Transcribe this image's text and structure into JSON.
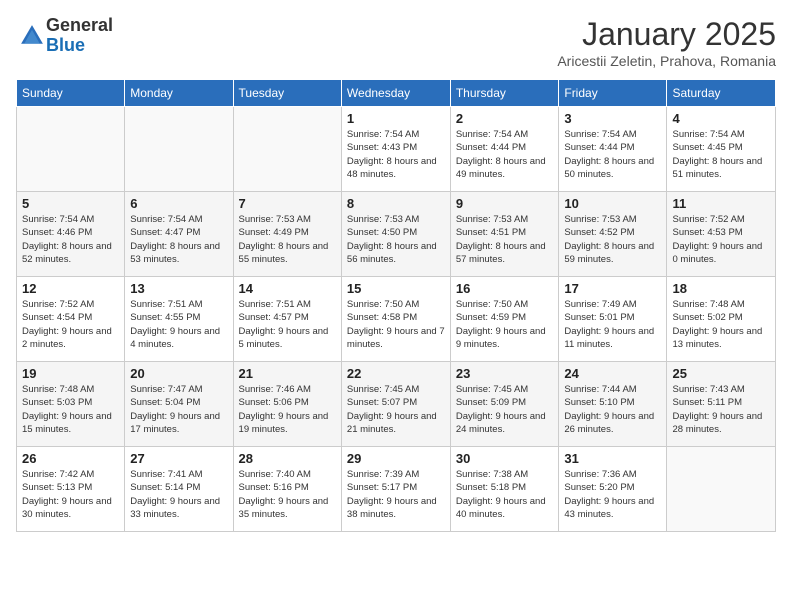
{
  "logo": {
    "general": "General",
    "blue": "Blue"
  },
  "title": "January 2025",
  "location": "Aricestii Zeletin, Prahova, Romania",
  "weekdays": [
    "Sunday",
    "Monday",
    "Tuesday",
    "Wednesday",
    "Thursday",
    "Friday",
    "Saturday"
  ],
  "weeks": [
    [
      {
        "day": "",
        "sunrise": "",
        "sunset": "",
        "daylight": ""
      },
      {
        "day": "",
        "sunrise": "",
        "sunset": "",
        "daylight": ""
      },
      {
        "day": "",
        "sunrise": "",
        "sunset": "",
        "daylight": ""
      },
      {
        "day": "1",
        "sunrise": "Sunrise: 7:54 AM",
        "sunset": "Sunset: 4:43 PM",
        "daylight": "Daylight: 8 hours and 48 minutes."
      },
      {
        "day": "2",
        "sunrise": "Sunrise: 7:54 AM",
        "sunset": "Sunset: 4:44 PM",
        "daylight": "Daylight: 8 hours and 49 minutes."
      },
      {
        "day": "3",
        "sunrise": "Sunrise: 7:54 AM",
        "sunset": "Sunset: 4:44 PM",
        "daylight": "Daylight: 8 hours and 50 minutes."
      },
      {
        "day": "4",
        "sunrise": "Sunrise: 7:54 AM",
        "sunset": "Sunset: 4:45 PM",
        "daylight": "Daylight: 8 hours and 51 minutes."
      }
    ],
    [
      {
        "day": "5",
        "sunrise": "Sunrise: 7:54 AM",
        "sunset": "Sunset: 4:46 PM",
        "daylight": "Daylight: 8 hours and 52 minutes."
      },
      {
        "day": "6",
        "sunrise": "Sunrise: 7:54 AM",
        "sunset": "Sunset: 4:47 PM",
        "daylight": "Daylight: 8 hours and 53 minutes."
      },
      {
        "day": "7",
        "sunrise": "Sunrise: 7:53 AM",
        "sunset": "Sunset: 4:49 PM",
        "daylight": "Daylight: 8 hours and 55 minutes."
      },
      {
        "day": "8",
        "sunrise": "Sunrise: 7:53 AM",
        "sunset": "Sunset: 4:50 PM",
        "daylight": "Daylight: 8 hours and 56 minutes."
      },
      {
        "day": "9",
        "sunrise": "Sunrise: 7:53 AM",
        "sunset": "Sunset: 4:51 PM",
        "daylight": "Daylight: 8 hours and 57 minutes."
      },
      {
        "day": "10",
        "sunrise": "Sunrise: 7:53 AM",
        "sunset": "Sunset: 4:52 PM",
        "daylight": "Daylight: 8 hours and 59 minutes."
      },
      {
        "day": "11",
        "sunrise": "Sunrise: 7:52 AM",
        "sunset": "Sunset: 4:53 PM",
        "daylight": "Daylight: 9 hours and 0 minutes."
      }
    ],
    [
      {
        "day": "12",
        "sunrise": "Sunrise: 7:52 AM",
        "sunset": "Sunset: 4:54 PM",
        "daylight": "Daylight: 9 hours and 2 minutes."
      },
      {
        "day": "13",
        "sunrise": "Sunrise: 7:51 AM",
        "sunset": "Sunset: 4:55 PM",
        "daylight": "Daylight: 9 hours and 4 minutes."
      },
      {
        "day": "14",
        "sunrise": "Sunrise: 7:51 AM",
        "sunset": "Sunset: 4:57 PM",
        "daylight": "Daylight: 9 hours and 5 minutes."
      },
      {
        "day": "15",
        "sunrise": "Sunrise: 7:50 AM",
        "sunset": "Sunset: 4:58 PM",
        "daylight": "Daylight: 9 hours and 7 minutes."
      },
      {
        "day": "16",
        "sunrise": "Sunrise: 7:50 AM",
        "sunset": "Sunset: 4:59 PM",
        "daylight": "Daylight: 9 hours and 9 minutes."
      },
      {
        "day": "17",
        "sunrise": "Sunrise: 7:49 AM",
        "sunset": "Sunset: 5:01 PM",
        "daylight": "Daylight: 9 hours and 11 minutes."
      },
      {
        "day": "18",
        "sunrise": "Sunrise: 7:48 AM",
        "sunset": "Sunset: 5:02 PM",
        "daylight": "Daylight: 9 hours and 13 minutes."
      }
    ],
    [
      {
        "day": "19",
        "sunrise": "Sunrise: 7:48 AM",
        "sunset": "Sunset: 5:03 PM",
        "daylight": "Daylight: 9 hours and 15 minutes."
      },
      {
        "day": "20",
        "sunrise": "Sunrise: 7:47 AM",
        "sunset": "Sunset: 5:04 PM",
        "daylight": "Daylight: 9 hours and 17 minutes."
      },
      {
        "day": "21",
        "sunrise": "Sunrise: 7:46 AM",
        "sunset": "Sunset: 5:06 PM",
        "daylight": "Daylight: 9 hours and 19 minutes."
      },
      {
        "day": "22",
        "sunrise": "Sunrise: 7:45 AM",
        "sunset": "Sunset: 5:07 PM",
        "daylight": "Daylight: 9 hours and 21 minutes."
      },
      {
        "day": "23",
        "sunrise": "Sunrise: 7:45 AM",
        "sunset": "Sunset: 5:09 PM",
        "daylight": "Daylight: 9 hours and 24 minutes."
      },
      {
        "day": "24",
        "sunrise": "Sunrise: 7:44 AM",
        "sunset": "Sunset: 5:10 PM",
        "daylight": "Daylight: 9 hours and 26 minutes."
      },
      {
        "day": "25",
        "sunrise": "Sunrise: 7:43 AM",
        "sunset": "Sunset: 5:11 PM",
        "daylight": "Daylight: 9 hours and 28 minutes."
      }
    ],
    [
      {
        "day": "26",
        "sunrise": "Sunrise: 7:42 AM",
        "sunset": "Sunset: 5:13 PM",
        "daylight": "Daylight: 9 hours and 30 minutes."
      },
      {
        "day": "27",
        "sunrise": "Sunrise: 7:41 AM",
        "sunset": "Sunset: 5:14 PM",
        "daylight": "Daylight: 9 hours and 33 minutes."
      },
      {
        "day": "28",
        "sunrise": "Sunrise: 7:40 AM",
        "sunset": "Sunset: 5:16 PM",
        "daylight": "Daylight: 9 hours and 35 minutes."
      },
      {
        "day": "29",
        "sunrise": "Sunrise: 7:39 AM",
        "sunset": "Sunset: 5:17 PM",
        "daylight": "Daylight: 9 hours and 38 minutes."
      },
      {
        "day": "30",
        "sunrise": "Sunrise: 7:38 AM",
        "sunset": "Sunset: 5:18 PM",
        "daylight": "Daylight: 9 hours and 40 minutes."
      },
      {
        "day": "31",
        "sunrise": "Sunrise: 7:36 AM",
        "sunset": "Sunset: 5:20 PM",
        "daylight": "Daylight: 9 hours and 43 minutes."
      },
      {
        "day": "",
        "sunrise": "",
        "sunset": "",
        "daylight": ""
      }
    ]
  ]
}
